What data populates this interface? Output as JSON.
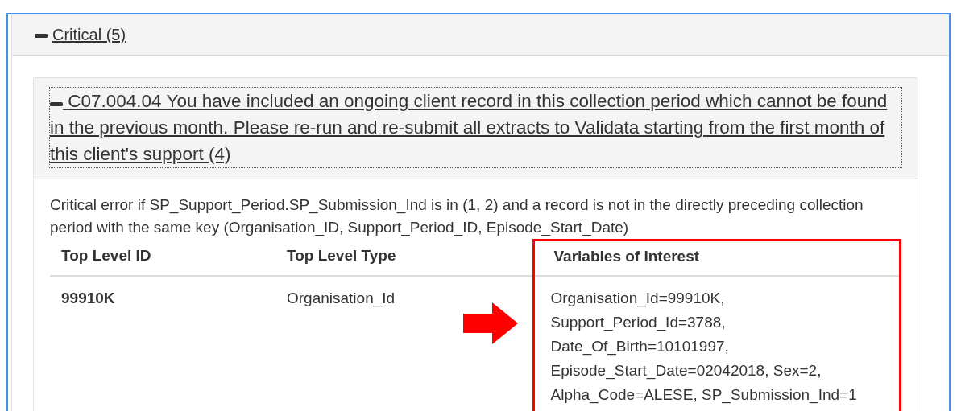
{
  "section": {
    "title": "Critical (5)",
    "expanded": true,
    "error": {
      "title": "C07.004.04 You have included an ongoing client record in this collection period which cannot be found in the previous month. Please re-run and re-submit all extracts to Validata starting from the first month of this client's support (4)",
      "expanded": true,
      "description": "Critical error if SP_Support_Period.SP_Submission_Ind is in (1, 2) and a record is not in the directly preceding collection period with the same key (Organisation_ID, Support_Period_ID, Episode_Start_Date)",
      "table": {
        "columns": [
          {
            "label": "Top Level ID",
            "highlighted": false
          },
          {
            "label": "Top Level Type",
            "highlighted": false
          },
          {
            "label": "Variables of Interest",
            "highlighted": true
          }
        ],
        "rows": [
          [
            "99910K",
            "Organisation_Id",
            "Organisation_Id=99910K, Support_Period_Id=3788, Date_Of_Birth=10101997, Episode_Start_Date=02042018, Sex=2, Alpha_Code=ALESE, SP_Submission_Ind=1"
          ]
        ]
      }
    }
  }
}
